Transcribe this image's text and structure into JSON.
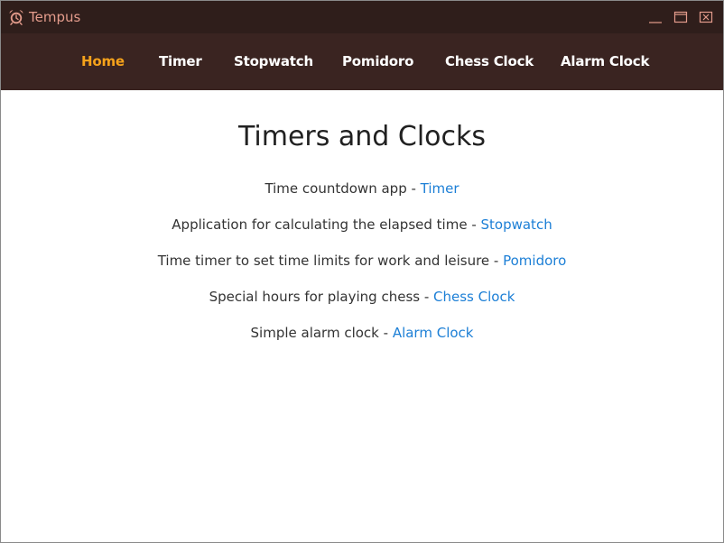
{
  "window": {
    "title": "Tempus",
    "icon": "alarm-clock-icon"
  },
  "colors": {
    "titlebar_bg": "#2f1e1b",
    "navbar_bg": "#3a2421",
    "active_nav": "#f5a21b",
    "link": "#1c7fd6"
  },
  "nav": {
    "items": [
      {
        "label": "Home",
        "active": true
      },
      {
        "label": "Timer",
        "active": false
      },
      {
        "label": "Stopwatch",
        "active": false
      },
      {
        "label": "Pomidoro",
        "active": false
      },
      {
        "label": "Chess Clock",
        "active": false
      },
      {
        "label": "Alarm Clock",
        "active": false
      }
    ]
  },
  "main": {
    "title": "Timers and Clocks",
    "lines": [
      {
        "text": "Time countdown app - ",
        "link": "Timer"
      },
      {
        "text": "Application for calculating the elapsed time - ",
        "link": "Stopwatch"
      },
      {
        "text": "Time timer to set time limits for work and leisure - ",
        "link": "Pomidoro"
      },
      {
        "text": "Special hours for playing chess - ",
        "link": "Chess Clock"
      },
      {
        "text": "Simple alarm clock - ",
        "link": "Alarm Clock"
      }
    ]
  }
}
